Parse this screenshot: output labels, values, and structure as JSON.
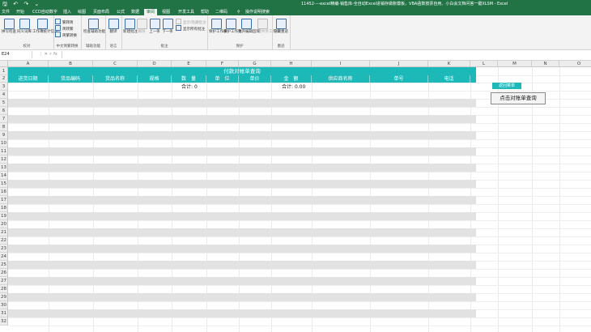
{
  "titlebar": {
    "qa_save": "🖫",
    "qa_undo": "↶",
    "qa_redo": "↷",
    "qa_more": "⌄",
    "doc_title": "11452----excel精编-销售库-全自动Excel进销存做账模板，VBA函数按票自用、小白会文档问答一键XLSM - Excel"
  },
  "tabs": [
    "文件",
    "开始",
    "CCD自动数字",
    "插入",
    "绘图",
    "页面布局",
    "公式",
    "数据",
    "审阅",
    "视图",
    "开发工具",
    "帮助",
    "二维码"
  ],
  "active_tab_index": 8,
  "tell_me": "操作说明搜索",
  "ribbon": {
    "groups": [
      {
        "label": "校对"
      },
      {
        "label": "中文简繁转换"
      },
      {
        "label": "辅助功能"
      },
      {
        "label": "语言"
      },
      {
        "label": "批注"
      },
      {
        "label": "保护"
      },
      {
        "label": "墨迹"
      }
    ],
    "buttons": {
      "spelling": "拼写检查",
      "thesaurus": "同义词库",
      "workbook_stats": "工作簿统计信息",
      "to_traditional": "繁转简",
      "to_simplified": "简转繁",
      "convert": "简繁转换",
      "check_access": "检查辅助功能",
      "translate": "翻译",
      "new_comment": "新建批注",
      "delete": "删除",
      "prev": "上一条",
      "next": "下一条",
      "show_comment": "显示/隐藏批注",
      "show_all": "显示所有批注",
      "protect_sheet": "保护工作表",
      "protect_workbook": "保护工作簿",
      "allow_edit": "允许编辑区域",
      "unshare": "取消共享工作簿",
      "hide_ink": "隐藏墨迹"
    }
  },
  "formula_bar": {
    "name_box": "E24",
    "fx_icons": "⋮  ✕  ✓  fx",
    "content": ""
  },
  "columns": [
    "A",
    "B",
    "C",
    "D",
    "E",
    "F",
    "G",
    "H",
    "I",
    "J",
    "K",
    "L",
    "M",
    "N",
    "O"
  ],
  "rows": [
    "1",
    "2",
    "3",
    "4",
    "5",
    "6",
    "7",
    "8",
    "9",
    "10",
    "11",
    "12",
    "13",
    "14",
    "15",
    "16",
    "17",
    "18",
    "19",
    "20",
    "21",
    "22",
    "23",
    "24",
    "25",
    "26",
    "27",
    "28",
    "29",
    "30",
    "31",
    "32"
  ],
  "table": {
    "title": "付款对帐单查询",
    "headers": [
      "进货日期",
      "货品编码",
      "货品名称",
      "规格",
      "数　量",
      "单　位",
      "单价",
      "金　额",
      "供应商名称",
      "单号",
      "电话"
    ],
    "sum_label_1": "合计:",
    "sum_value_1": "0",
    "sum_label_2": "合计:",
    "sum_value_2": "0.00"
  },
  "side": {
    "menu_button": "返回菜单",
    "query_button": "点击对账单查询"
  },
  "colors": {
    "excel_green": "#217346",
    "teal_header": "#1cb9b8",
    "row_stripe": "#e2e2e2"
  }
}
